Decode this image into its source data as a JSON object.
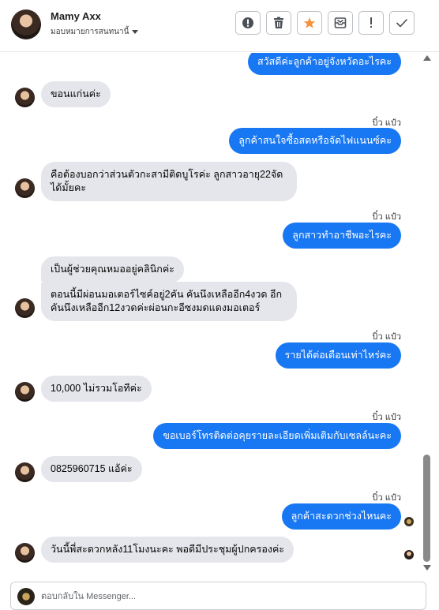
{
  "header": {
    "contact_name": "Mamy Axx",
    "assign_label": "มอบหมายการสนทนานี้"
  },
  "toolbar": {
    "spam_icon": "exclamation-circle-icon",
    "delete_icon": "trash-icon",
    "star_icon": "star-icon",
    "archive_icon": "archive-icon",
    "important_icon": "exclamation-icon",
    "done_icon": "check-icon",
    "star_color": "#f7923a"
  },
  "messages": [
    {
      "from": "me",
      "text": "สวัสดีค่ะลูกค้าอยู่จังหวัดอะไรคะ"
    },
    {
      "from": "them",
      "text": "ขอนแก่นค่ะ"
    },
    {
      "from": "me",
      "seen": "บิ๋ว แป๋ว",
      "text": "ลูกค้าสนใจซื้อสดหรือจัดไฟแนนซ์คะ"
    },
    {
      "from": "them",
      "text": "คือต้องบอกว่าส่วนตัวกะสามีติดบูโรค่ะ ลูกสาวอายุ22จัดได้มั้ยคะ"
    },
    {
      "from": "me",
      "seen": "บิ๋ว แป๋ว",
      "text": "ลูกสาวทำอาชีพอะไรคะ"
    },
    {
      "from": "them",
      "text": "เป็นผู้ช่วยคุณหมออยู่คลินิกค่ะ"
    },
    {
      "from": "them",
      "text": "ตอนนี้มีผ่อนมอเตอร์ไซค์อยู่2คัน คันนึงเหลืออีก4งวด อีกคันนึงเหลืออีก12งวดค่ะผ่อนกะอีซงมดแดงมอเตอร์"
    },
    {
      "from": "me",
      "seen": "บิ๋ว แป๋ว",
      "text": "รายได้ต่อเดือนเท่าไหร่คะ"
    },
    {
      "from": "them",
      "text": "10,000 ไม่รวมโอทีค่ะ"
    },
    {
      "from": "me",
      "seen": "บิ๋ว แป๋ว",
      "text": "ขอเบอร์โทรติดต่อคุยรายละเอียดเพิ่มเติมกับเซลล์นะคะ"
    },
    {
      "from": "them",
      "text": "0825960715 แอ้ค่ะ"
    },
    {
      "from": "me",
      "seen": "บิ๋ว แป๋ว",
      "text": "ลูกค้าสะดวกช่วงไหนคะ"
    },
    {
      "from": "them",
      "text": "วันนี้พี่สะดวกหลัง11โมงนะคะ พอดีมีประชุมผู้ปกครองค่ะ"
    }
  ],
  "composer": {
    "placeholder": "ตอบกลับใน Messenger..."
  },
  "colors": {
    "outgoing_bubble": "#1877f2",
    "incoming_bubble": "#e4e6eb"
  }
}
